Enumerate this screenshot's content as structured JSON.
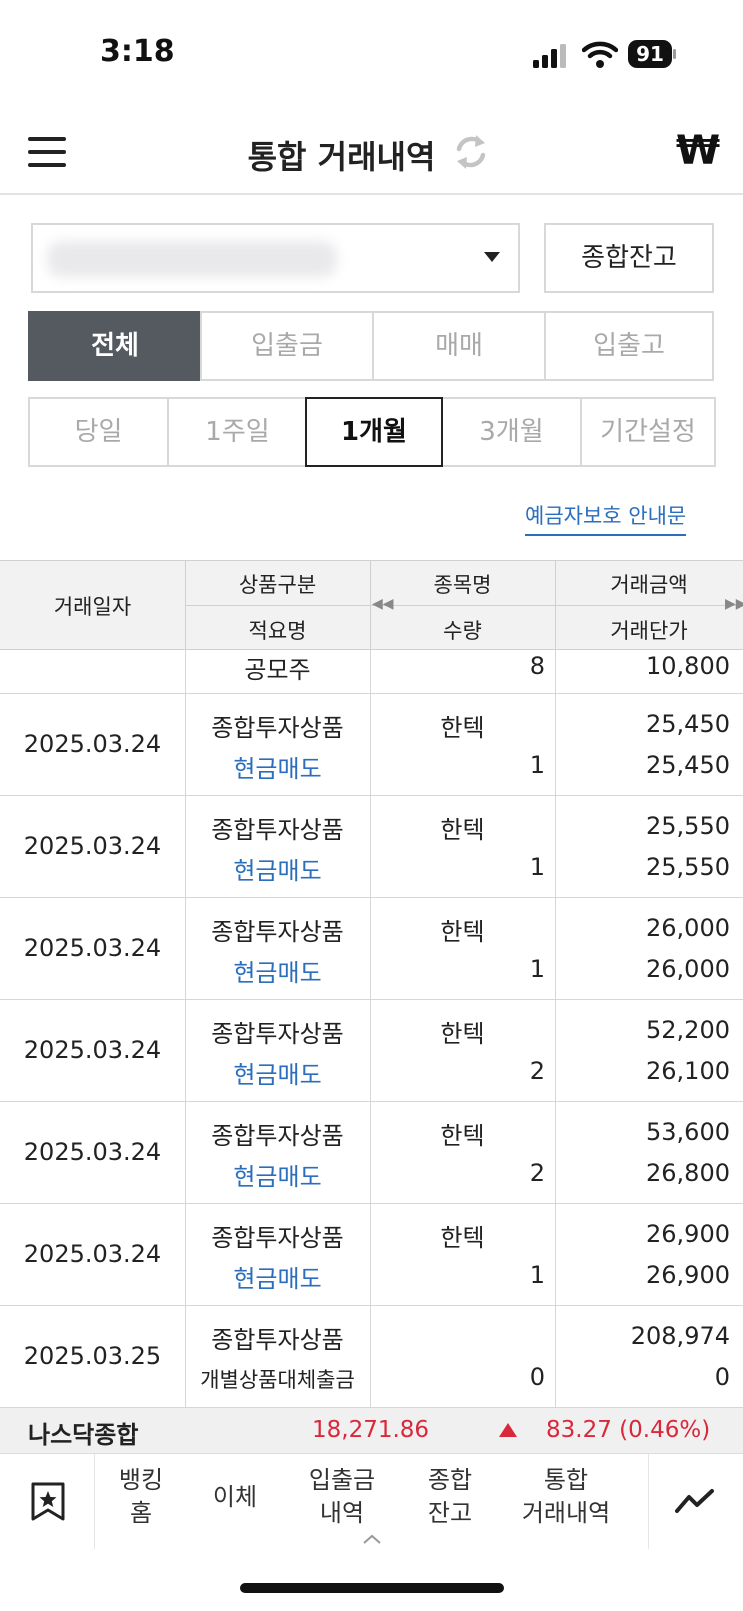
{
  "status_bar": {
    "time": "3:18",
    "battery": "91"
  },
  "header": {
    "title": "통합 거래내역",
    "currency_symbol": "₩"
  },
  "account": {
    "balance_button": "종합잔고"
  },
  "category_tabs": [
    "전체",
    "입출금",
    "매매",
    "입출고"
  ],
  "category_active": "전체",
  "period_tabs": [
    "당일",
    "1주일",
    "1개월",
    "3개월",
    "기간설정"
  ],
  "period_active": "1개월",
  "protection_link": "예금자보호 안내문",
  "table": {
    "headers": {
      "date": "거래일자",
      "product_type": "상품구분",
      "summary": "적요명",
      "item_name": "종목명",
      "quantity": "수량",
      "amount": "거래금액",
      "unit_price": "거래단가"
    },
    "partial_row": {
      "category": "공모주",
      "quantity": "8",
      "unit_price": "10,800"
    },
    "rows": [
      {
        "date": "2025.03.24",
        "category": "종합투자상품",
        "summary": "현금매도",
        "item": "한텍",
        "quantity": "1",
        "amount": "25,450",
        "unit_price": "25,450"
      },
      {
        "date": "2025.03.24",
        "category": "종합투자상품",
        "summary": "현금매도",
        "item": "한텍",
        "quantity": "1",
        "amount": "25,550",
        "unit_price": "25,550"
      },
      {
        "date": "2025.03.24",
        "category": "종합투자상품",
        "summary": "현금매도",
        "item": "한텍",
        "quantity": "1",
        "amount": "26,000",
        "unit_price": "26,000"
      },
      {
        "date": "2025.03.24",
        "category": "종합투자상품",
        "summary": "현금매도",
        "item": "한텍",
        "quantity": "2",
        "amount": "52,200",
        "unit_price": "26,100"
      },
      {
        "date": "2025.03.24",
        "category": "종합투자상품",
        "summary": "현금매도",
        "item": "한텍",
        "quantity": "2",
        "amount": "53,600",
        "unit_price": "26,800"
      },
      {
        "date": "2025.03.24",
        "category": "종합투자상품",
        "summary": "현금매도",
        "item": "한텍",
        "quantity": "1",
        "amount": "26,900",
        "unit_price": "26,900"
      },
      {
        "date": "2025.03.25",
        "category": "종합투자상품",
        "summary": "개별상품대체출금",
        "item": "",
        "quantity": "0",
        "amount": "208,974",
        "unit_price": "0"
      }
    ]
  },
  "index_ticker": {
    "name": "나스닥종합",
    "value": "18,271.86",
    "change": "83.27 (0.46%)"
  },
  "bottom_nav": {
    "items": [
      {
        "line1": "뱅킹",
        "line2": "홈"
      },
      {
        "line1": "이체",
        "line2": ""
      },
      {
        "line1": "입출금",
        "line2": "내역"
      },
      {
        "line1": "종합",
        "line2": "잔고"
      },
      {
        "line1": "통합",
        "line2": "거래내역"
      }
    ]
  },
  "colors": {
    "accent_blue": "#2a6ebd",
    "up_red": "#d8283a",
    "active_tab": "#555a60"
  },
  "icons": [
    "menu-icon",
    "refresh-icon",
    "won-icon",
    "bookmark-icon",
    "chart-trend-icon",
    "signal-icon",
    "wifi-icon",
    "battery-icon"
  ]
}
